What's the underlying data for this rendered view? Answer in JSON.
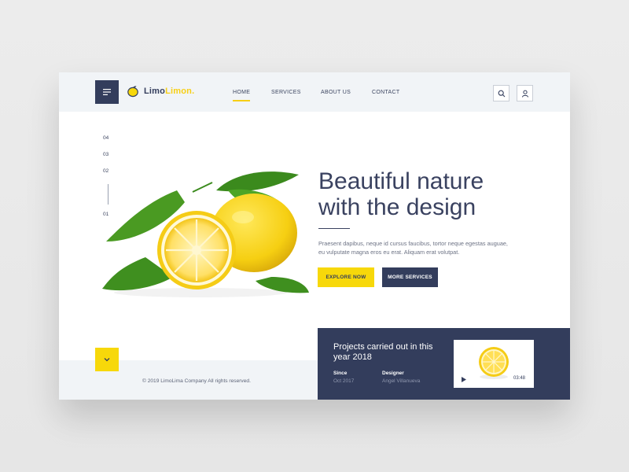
{
  "header": {
    "logo_primary": "Limo",
    "logo_accent": "Limon.",
    "nav": [
      {
        "label": "HOME",
        "active": true
      },
      {
        "label": "SERVICES",
        "active": false
      },
      {
        "label": "ABOUT US",
        "active": false
      },
      {
        "label": "CONTACT",
        "active": false
      }
    ],
    "icons": [
      "menu-icon",
      "lemon-logo-icon",
      "search-icon",
      "user-icon"
    ]
  },
  "pager": {
    "items": [
      "04",
      "03",
      "02",
      "01"
    ]
  },
  "hero": {
    "headline_line1": "Beautiful nature",
    "headline_line2": "with the design",
    "description": "Praesent dapibus, neque id cursus faucibus, tortor neque egestas auguae, eu vulputate magna eros eu erat. Aliquam erat volutpat.",
    "primary_button": "EXPLORE NOW",
    "secondary_button": "MORE SERVICES"
  },
  "footer": {
    "copyright": "© 2019 LimoLima Company All rights reserved.",
    "scroll_icon": "chevron-down-icon"
  },
  "projects": {
    "title": "Projects carried out in this year 2018",
    "since_label": "Since",
    "since_value": "Oct 2017",
    "designer_label": "Designer",
    "designer_value": "Angel Villanueva",
    "video_duration": "03:48",
    "play_icon": "play-icon"
  },
  "colors": {
    "accent": "#f7d80a",
    "navy": "#333d5c",
    "light_bg": "#f1f4f7"
  }
}
